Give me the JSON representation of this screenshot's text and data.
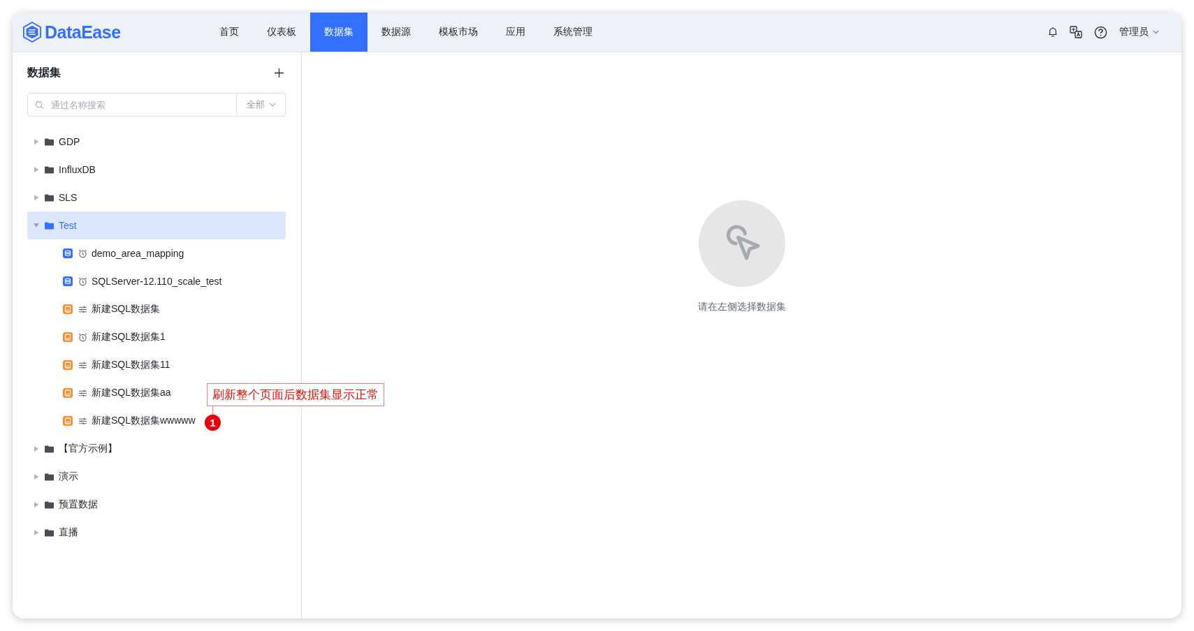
{
  "header": {
    "logo": "DataEase",
    "nav": [
      {
        "label": "首页",
        "selected": false
      },
      {
        "label": "仪表板",
        "selected": false
      },
      {
        "label": "数据集",
        "selected": true
      },
      {
        "label": "数据源",
        "selected": false
      },
      {
        "label": "模板市场",
        "selected": false
      },
      {
        "label": "应用",
        "selected": false
      },
      {
        "label": "系统管理",
        "selected": false
      }
    ],
    "user": "管理员"
  },
  "sidebar": {
    "title": "数据集",
    "search": {
      "placeholder": "通过名称搜索"
    },
    "filter": "全部"
  },
  "tree": {
    "items": [
      {
        "kind": "folder",
        "label": "GDP",
        "expanded": false,
        "selected": false
      },
      {
        "kind": "folder",
        "label": "InfluxDB",
        "expanded": false,
        "selected": false
      },
      {
        "kind": "folder",
        "label": "SLS",
        "expanded": false,
        "selected": false
      },
      {
        "kind": "folder",
        "label": "Test",
        "expanded": true,
        "selected": true,
        "children": [
          {
            "kind": "db",
            "scheduled": true,
            "label": "demo_area_mapping",
            "selected": false
          },
          {
            "kind": "db",
            "scheduled": true,
            "label": "SQLServer-12.110_scale_test",
            "selected": false
          },
          {
            "kind": "sql",
            "scheduled": false,
            "label": "新建SQL数据集",
            "selected": false
          },
          {
            "kind": "sql",
            "scheduled": true,
            "label": "新建SQL数据集1",
            "selected": false
          },
          {
            "kind": "sql",
            "scheduled": false,
            "label": "新建SQL数据集11",
            "selected": false
          },
          {
            "kind": "sql",
            "scheduled": false,
            "label": "新建SQL数据集aa",
            "selected": false
          },
          {
            "kind": "sql",
            "scheduled": false,
            "label": "新建SQL数据集wwwww",
            "selected": false
          }
        ]
      },
      {
        "kind": "folder",
        "label": "【官方示例】",
        "expanded": false,
        "selected": false
      },
      {
        "kind": "folder",
        "label": "演示",
        "expanded": false,
        "selected": false
      },
      {
        "kind": "folder",
        "label": "预置数据",
        "expanded": false,
        "selected": false
      },
      {
        "kind": "folder",
        "label": "直播",
        "expanded": false,
        "selected": false
      }
    ]
  },
  "empty_state": {
    "message": "请在左侧选择数据集"
  },
  "annotation": {
    "text": "刷新整个页面后数据集显示正常",
    "number": "1"
  }
}
